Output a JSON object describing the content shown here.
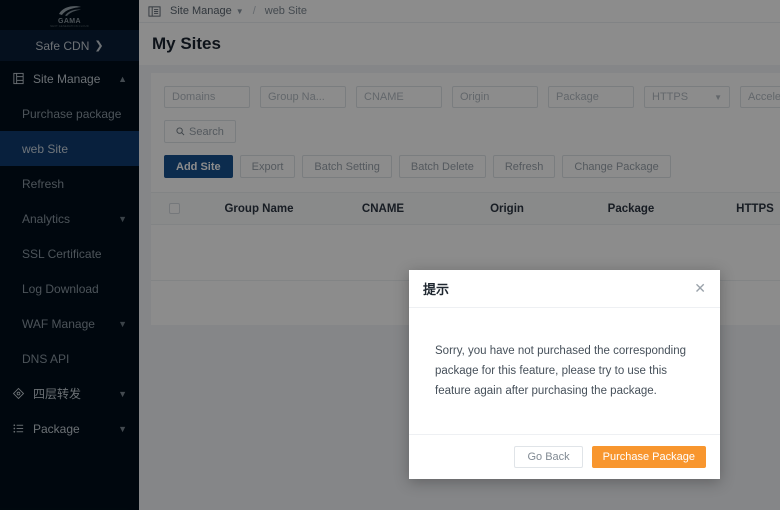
{
  "sidebar": {
    "logo": {
      "word": "GAMA",
      "sub": "NEXT GENERATION CLOUD",
      "icon": "swoosh-logo-icon"
    },
    "safe_cdn": {
      "label": "Safe CDN",
      "icon": "chevron-right-icon"
    },
    "site_manage": {
      "label": "Site Manage",
      "icon": "list-doc-icon",
      "caret": "chevron-up-icon"
    },
    "items": [
      {
        "label": "Purchase package",
        "active": false,
        "caret": ""
      },
      {
        "label": "web Site",
        "active": true,
        "caret": ""
      },
      {
        "label": "Refresh",
        "active": false,
        "caret": ""
      },
      {
        "label": "Analytics",
        "active": false,
        "caret": "chevron-down-icon"
      },
      {
        "label": "SSL Certificate",
        "active": false,
        "caret": ""
      },
      {
        "label": "Log Download",
        "active": false,
        "caret": ""
      },
      {
        "label": "WAF Manage",
        "active": false,
        "caret": "chevron-down-icon"
      },
      {
        "label": "DNS API",
        "active": false,
        "caret": ""
      }
    ],
    "groups": [
      {
        "label": "四层转发",
        "icon": "diamond-icon",
        "caret": "chevron-down-icon"
      },
      {
        "label": "Package",
        "icon": "list-icon",
        "caret": "chevron-down-icon"
      }
    ]
  },
  "topbar": {
    "menu_icon": "sidebar-collapse-icon",
    "breadcrumb_root": "Site Manage",
    "breadcrumb_caret": "chevron-down-icon",
    "breadcrumb_sep": "/",
    "breadcrumb_current": "web Site"
  },
  "page": {
    "title": "My Sites"
  },
  "filters": [
    {
      "name": "domains",
      "placeholder": "Domains",
      "type": "input"
    },
    {
      "name": "group-name",
      "placeholder": "Group Na...",
      "type": "input"
    },
    {
      "name": "cname",
      "placeholder": "CNAME",
      "type": "input"
    },
    {
      "name": "origin",
      "placeholder": "Origin",
      "type": "input"
    },
    {
      "name": "package",
      "placeholder": "Package",
      "type": "input"
    },
    {
      "name": "https",
      "placeholder": "HTTPS",
      "type": "select"
    },
    {
      "name": "accelerate",
      "placeholder": "Accelerate ...",
      "type": "select"
    }
  ],
  "search_button": {
    "label": "Search",
    "icon": "search-icon"
  },
  "actions": [
    {
      "name": "add-site",
      "label": "Add Site",
      "primary": true
    },
    {
      "name": "export",
      "label": "Export",
      "primary": false
    },
    {
      "name": "batch-setting",
      "label": "Batch Setting",
      "primary": false
    },
    {
      "name": "batch-delete",
      "label": "Batch Delete",
      "primary": false
    },
    {
      "name": "refresh",
      "label": "Refresh",
      "primary": false
    },
    {
      "name": "change-package",
      "label": "Change Package",
      "primary": false
    }
  ],
  "table": {
    "columns": [
      "Group Name",
      "CNAME",
      "Origin",
      "Package",
      "HTTPS"
    ],
    "rows": []
  },
  "modal": {
    "title": "提示",
    "close_icon": "close-icon",
    "body": "Sorry, you have not purchased the corresponding package for this feature, please try to use this feature again after purchasing the package.",
    "go_back_label": "Go Back",
    "purchase_label": "Purchase Package",
    "accent_color": "#f8962e"
  }
}
